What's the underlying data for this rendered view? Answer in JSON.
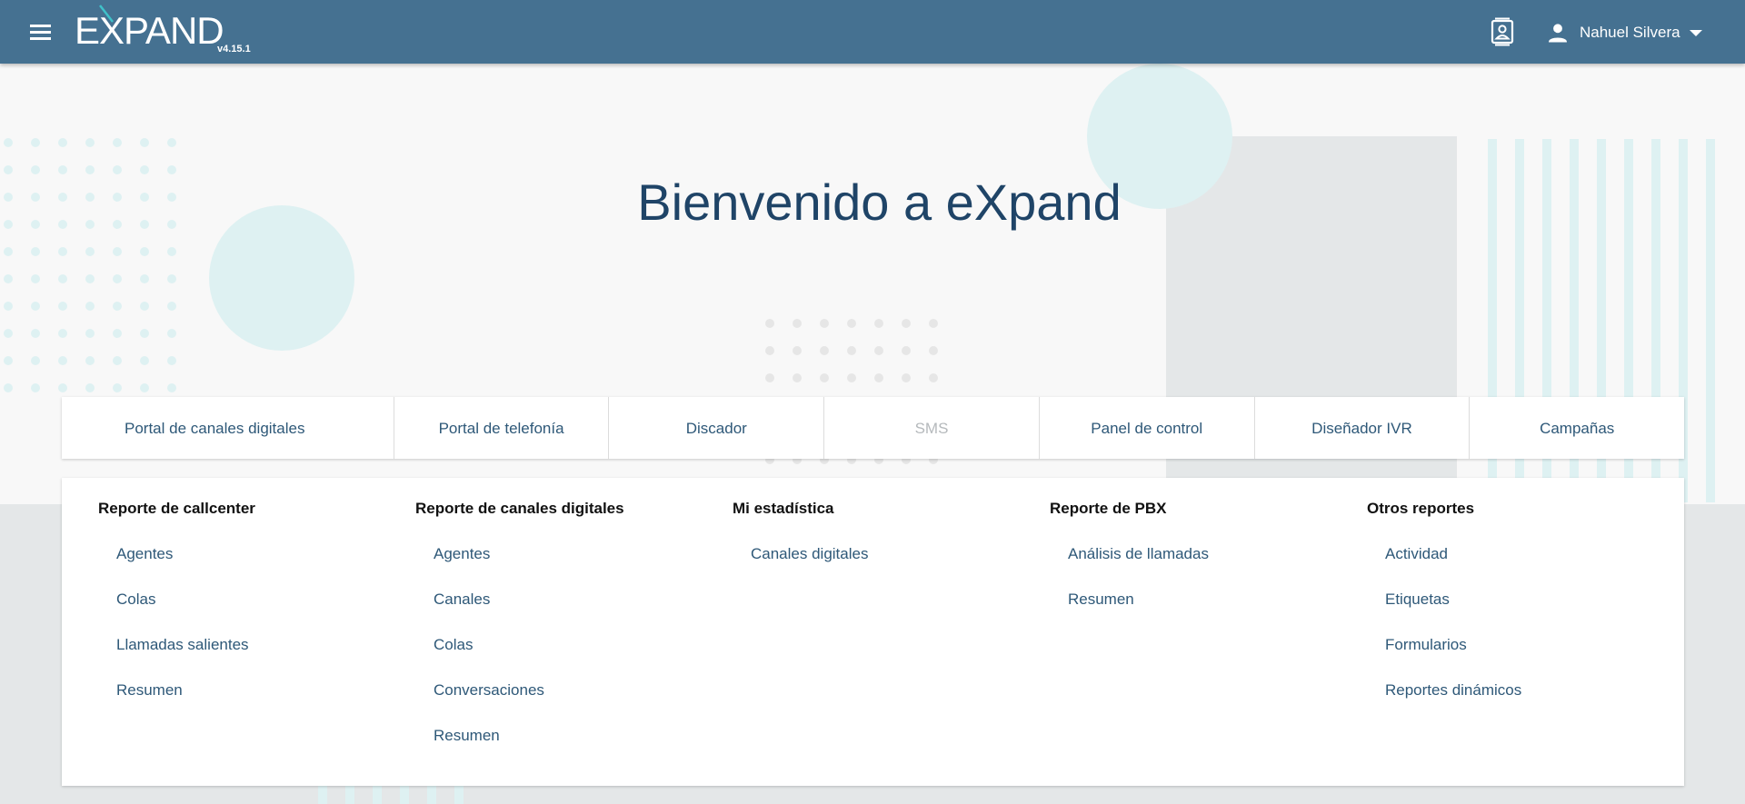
{
  "header": {
    "logo_text": "EXPAND",
    "version": "v4.15.1",
    "user_name": "Nahuel Silvera"
  },
  "main": {
    "title": "Bienvenido a eXpand"
  },
  "modules": [
    {
      "label": "Portal de canales digitales",
      "enabled": true
    },
    {
      "label": "Portal de telefonía",
      "enabled": true
    },
    {
      "label": "Discador",
      "enabled": true
    },
    {
      "label": "SMS",
      "enabled": false
    },
    {
      "label": "Panel de control",
      "enabled": true
    },
    {
      "label": "Diseñador IVR",
      "enabled": true
    },
    {
      "label": "Campañas",
      "enabled": true
    }
  ],
  "reports": [
    {
      "title": "Reporte de callcenter",
      "links": [
        "Agentes",
        "Colas",
        "Llamadas salientes",
        "Resumen"
      ]
    },
    {
      "title": "Reporte de canales digitales",
      "links": [
        "Agentes",
        "Canales",
        "Colas",
        "Conversaciones",
        "Resumen"
      ]
    },
    {
      "title": "Mi estadística",
      "links": [
        "Canales digitales"
      ]
    },
    {
      "title": "Reporte de PBX",
      "links": [
        "Análisis de llamadas",
        "Resumen"
      ]
    },
    {
      "title": "Otros reportes",
      "links": [
        "Actividad",
        "Etiquetas",
        "Formularios",
        "Reportes dinámicos"
      ]
    }
  ],
  "colors": {
    "topbar": "#457191",
    "accent_link": "#2e5878",
    "title": "#1f4467",
    "logo_accent": "#3fc1c9",
    "decor_teal": "#def1f2",
    "decor_grey": "#e4e7e8"
  },
  "icons": {
    "menu": "hamburger-menu-icon",
    "contact": "contact-card-icon",
    "user": "person-icon",
    "dropdown": "caret-down-icon"
  }
}
